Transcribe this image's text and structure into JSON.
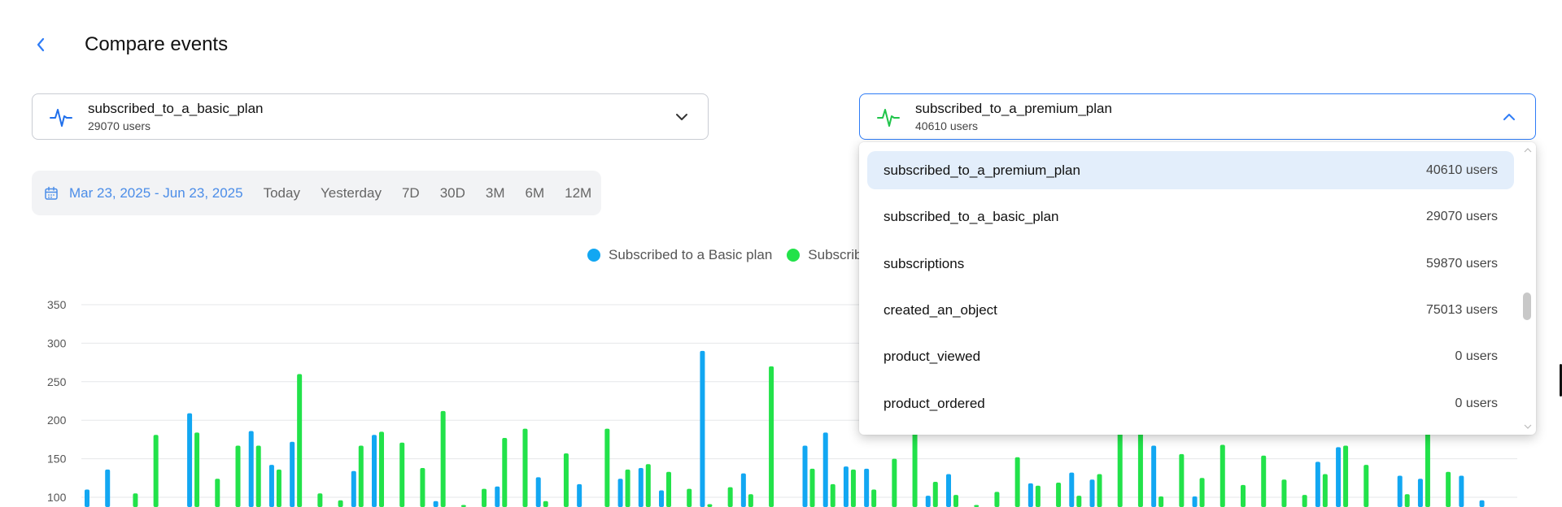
{
  "page": {
    "title": "Compare events"
  },
  "left_event": {
    "name": "subscribed_to_a_basic_plan",
    "count": "29070 users",
    "icon": "pulse-icon",
    "color": "#1f6feb"
  },
  "right_event": {
    "name": "subscribed_to_a_premium_plan",
    "count": "40610 users",
    "icon": "pulse-icon",
    "color": "#1fc44a"
  },
  "date_bar": {
    "range": "Mar 23, 2025 - Jun 23, 2025",
    "presets": [
      "Today",
      "Yesterday",
      "7D",
      "30D",
      "3M",
      "6M",
      "12M"
    ]
  },
  "dropdown": {
    "items": [
      {
        "name": "subscribed_to_a_premium_plan",
        "count": "40610 users",
        "selected": true
      },
      {
        "name": "subscribed_to_a_basic_plan",
        "count": "29070 users",
        "selected": false
      },
      {
        "name": "subscriptions",
        "count": "59870 users",
        "selected": false
      },
      {
        "name": "created_an_object",
        "count": "75013 users",
        "selected": false
      },
      {
        "name": "product_viewed",
        "count": "0 users",
        "selected": false
      },
      {
        "name": "product_ordered",
        "count": "0 users",
        "selected": false
      }
    ]
  },
  "colors": {
    "basic": "#12a7f2",
    "premium": "#22e24a",
    "accent": "#2e7cf6"
  },
  "chart_data": {
    "type": "bar",
    "title": "",
    "xlabel": "",
    "ylabel": "",
    "ylim": [
      0,
      350
    ],
    "yticks": [
      100,
      150,
      200,
      250,
      300,
      350
    ],
    "legend": [
      "Subscribed to a Basic plan",
      "Subscribe"
    ],
    "series": [
      {
        "name": "Subscribed to a Basic plan",
        "values": [
          110,
          136,
          0,
          0,
          0,
          209,
          0,
          0,
          186,
          142,
          172,
          0,
          0,
          134,
          181,
          0,
          0,
          95,
          0,
          0,
          114,
          0,
          126,
          0,
          117,
          0,
          124,
          138,
          109,
          0,
          290,
          0,
          131,
          0,
          0,
          167,
          184,
          140,
          137,
          0,
          0,
          102,
          130,
          0,
          0,
          0,
          118,
          0,
          132,
          123,
          0,
          0,
          167,
          0,
          101,
          0,
          0,
          0,
          0,
          0,
          146,
          165,
          0,
          0,
          128,
          124,
          0,
          128,
          96,
          0
        ]
      },
      {
        "name": "Subscribe",
        "values": [
          0,
          0,
          105,
          181,
          0,
          184,
          124,
          167,
          167,
          136,
          260,
          105,
          96,
          167,
          185,
          171,
          138,
          212,
          90,
          111,
          177,
          189,
          95,
          157,
          0,
          189,
          136,
          143,
          133,
          111,
          91,
          113,
          104,
          270,
          0,
          137,
          117,
          136,
          110,
          150,
          200,
          120,
          103,
          90,
          107,
          152,
          115,
          119,
          102,
          130,
          200,
          200,
          101,
          156,
          125,
          168,
          116,
          154,
          123,
          103,
          130,
          167,
          142,
          0,
          104,
          200,
          133,
          0,
          0,
          0
        ]
      }
    ]
  }
}
